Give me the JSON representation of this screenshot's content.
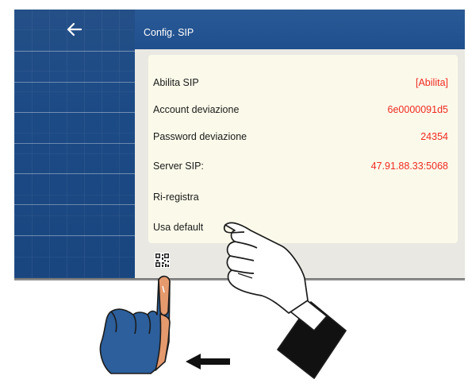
{
  "window": {
    "title": "Config. SIP"
  },
  "sidebar": {
    "back_icon": "arrow-left-icon",
    "rows": 7
  },
  "settings": [
    {
      "label": "Abilita SIP",
      "value": "[Abilita]"
    },
    {
      "label": "Account deviazione",
      "value": "6e0000091d5"
    },
    {
      "label": "Password deviazione",
      "value": "24354"
    },
    {
      "label": "Server SIP:",
      "value": "47.91.88.33:5068"
    },
    {
      "label": "Ri-registra",
      "value": ""
    },
    {
      "label": "Usa default",
      "value": ""
    }
  ],
  "qr_icon": "qr-code-icon",
  "colors": {
    "sidebar": "#1c4a85",
    "topbar": "#2a5a96",
    "panel": "#fbfaea",
    "value": "#f02a22"
  },
  "annotations": {
    "tap_hand": "pointing-hand-icon",
    "swipe_hand": "swipe-hand-icon",
    "arrow": "left-arrow-icon"
  }
}
